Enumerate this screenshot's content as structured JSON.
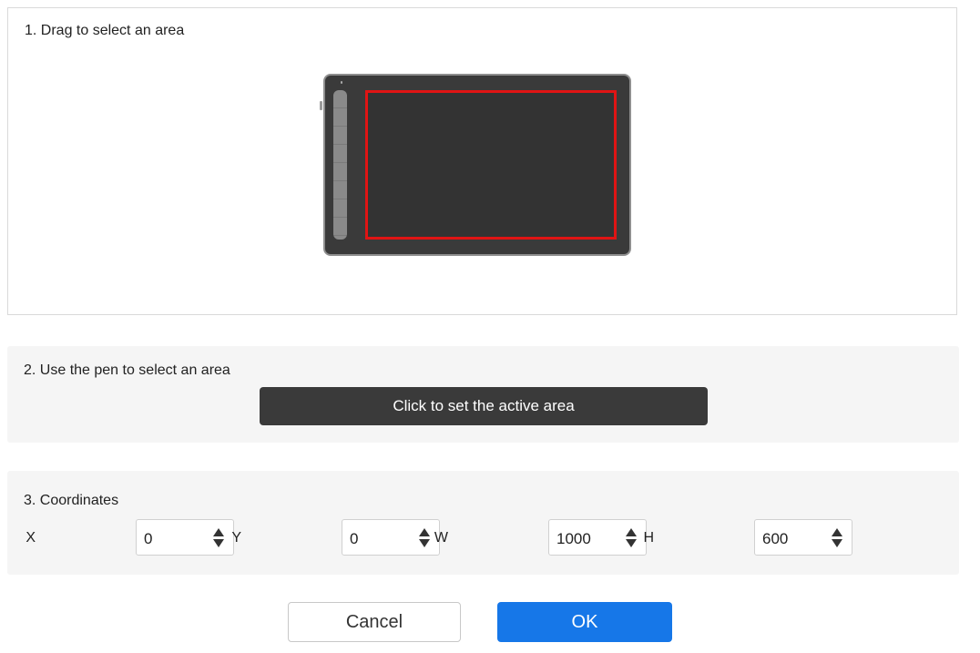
{
  "section1": {
    "label": "1. Drag to select an area"
  },
  "section2": {
    "label": "2. Use the pen to select an area",
    "button_label": "Click to set the active area"
  },
  "section3": {
    "label": "3. Coordinates",
    "fields": [
      {
        "axis": "X",
        "value": "0"
      },
      {
        "axis": "Y",
        "value": "0"
      },
      {
        "axis": "W",
        "value": "1000"
      },
      {
        "axis": "H",
        "value": "600"
      }
    ]
  },
  "footer": {
    "cancel_label": "Cancel",
    "ok_label": "OK"
  },
  "colors": {
    "accent": "#1677e8",
    "selection": "#e01414",
    "tablet": "#3a3a3a"
  }
}
